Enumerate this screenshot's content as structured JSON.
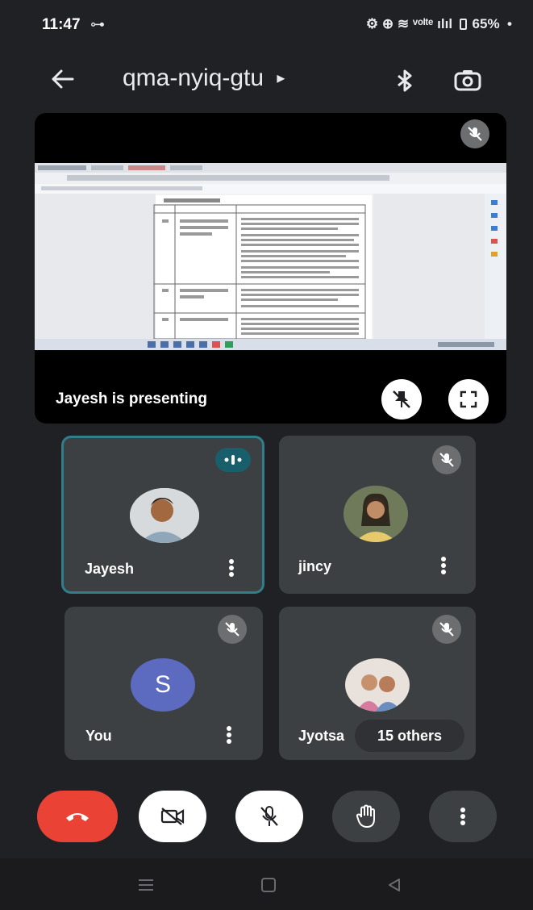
{
  "status": {
    "time": "11:47",
    "battery": "65%",
    "indicators": "⚙ ⊕ ≋ ᵛᵒˡᵗᵉ ılıl"
  },
  "header": {
    "meeting_code": "qma-nyiq-gtu",
    "expand_marker": "▸"
  },
  "stage": {
    "presenting_label": "Jayesh is presenting"
  },
  "participants": [
    {
      "name": "Jayesh",
      "speaking": true
    },
    {
      "name": "jincy",
      "muted": true
    },
    {
      "name": "You",
      "initial": "S",
      "avatar_color": "#5c6bc0",
      "muted": true
    },
    {
      "name": "Jyotsa",
      "muted": true
    }
  ],
  "others": {
    "label": "15 others"
  },
  "colors": {
    "end_call": "#ea4335",
    "active_border": "#2f7e8a",
    "tile_bg": "#3c4043"
  }
}
